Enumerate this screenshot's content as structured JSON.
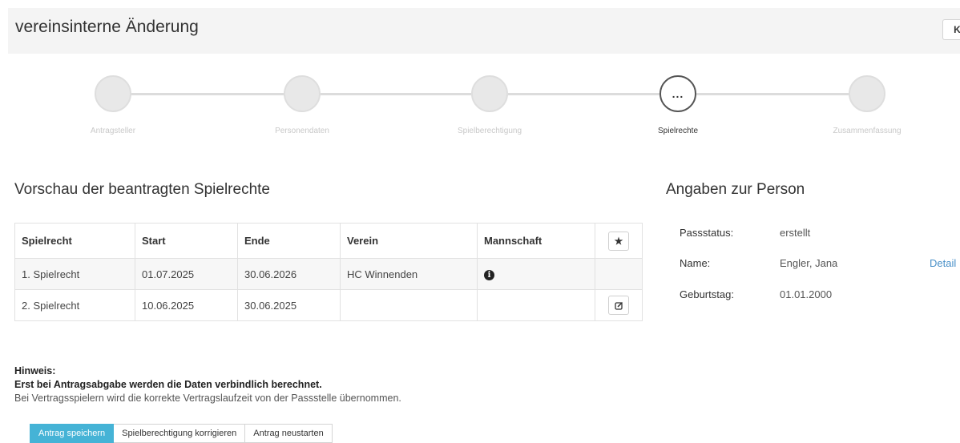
{
  "header": {
    "title": "vereinsinterne Änderung",
    "button_label": "K"
  },
  "wizard": {
    "steps": [
      {
        "label": "Antragsteller",
        "active": false
      },
      {
        "label": "Personendaten",
        "active": false
      },
      {
        "label": "Spielberechtigung",
        "active": false
      },
      {
        "label": "Spielrechte",
        "active": true,
        "marker": "..."
      },
      {
        "label": "Zusammenfassung",
        "active": false
      }
    ]
  },
  "preview": {
    "title": "Vorschau der beantragten Spielrechte",
    "columns": [
      "Spielrecht",
      "Start",
      "Ende",
      "Verein",
      "Mannschaft"
    ],
    "rows": [
      {
        "spielrecht": "1. Spielrecht",
        "start": "01.07.2025",
        "ende": "30.06.2026",
        "verein": "HC Winnenden",
        "mannschaft_icon": "info-icon"
      },
      {
        "spielrecht": "2. Spielrecht",
        "start": "10.06.2025",
        "ende": "30.06.2025",
        "verein": "",
        "action_icon": "edit-icon"
      }
    ]
  },
  "person": {
    "title": "Angaben zur Person",
    "passstatus_label": "Passstatus:",
    "passstatus_value": "erstellt",
    "name_label": "Name:",
    "name_value": "Engler, Jana",
    "detail_link": "Detail",
    "geburtstag_label": "Geburtstag:",
    "geburtstag_value": "01.01.2000"
  },
  "hint": {
    "label": "Hinweis:",
    "bold_text": "Erst bei Antragsabgabe werden die Daten verbindlich berechnet.",
    "text": "Bei Vertragsspielern wird die korrekte Vertragslaufzeit von der Passstelle übernommen."
  },
  "actions": {
    "save": "Antrag speichern",
    "correct": "Spielberechtigung korrigieren",
    "restart": "Antrag neustarten"
  },
  "colors": {
    "primary": "#45b3d6",
    "link": "#4a90c8"
  }
}
